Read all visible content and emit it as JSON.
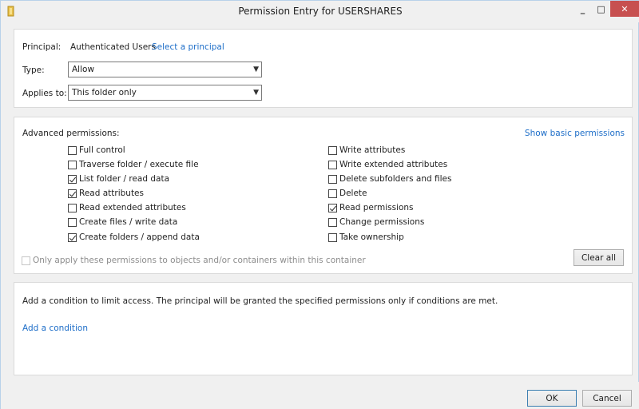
{
  "window": {
    "title": "Permission Entry for USERSHARES",
    "minimize_label": "_",
    "maximize_label": "□",
    "close_label": "✕"
  },
  "principal": {
    "label": "Principal:",
    "value": "Authenticated Users",
    "link": "Select a principal"
  },
  "type": {
    "label": "Type:",
    "value": "Allow"
  },
  "applies_to": {
    "label": "Applies to:",
    "value": "This folder only"
  },
  "permissions": {
    "heading": "Advanced permissions:",
    "show_basic_link": "Show basic permissions",
    "left": [
      {
        "label": "Full control",
        "checked": false
      },
      {
        "label": "Traverse folder / execute file",
        "checked": false
      },
      {
        "label": "List folder / read data",
        "checked": true
      },
      {
        "label": "Read attributes",
        "checked": true
      },
      {
        "label": "Read extended attributes",
        "checked": false
      },
      {
        "label": "Create files / write data",
        "checked": false
      },
      {
        "label": "Create folders / append data",
        "checked": true
      }
    ],
    "right": [
      {
        "label": "Write attributes",
        "checked": false
      },
      {
        "label": "Write extended attributes",
        "checked": false
      },
      {
        "label": "Delete subfolders and files",
        "checked": false
      },
      {
        "label": "Delete",
        "checked": false
      },
      {
        "label": "Read permissions",
        "checked": true
      },
      {
        "label": "Change permissions",
        "checked": false
      },
      {
        "label": "Take ownership",
        "checked": false
      }
    ],
    "only_apply_label": "Only apply these permissions to objects and/or containers within this container",
    "clear_all_label": "Clear all"
  },
  "condition": {
    "description": "Add a condition to limit access. The principal will be granted the specified permissions only if conditions are met.",
    "add_link": "Add a condition"
  },
  "footer": {
    "ok_label": "OK",
    "cancel_label": "Cancel"
  },
  "colors": {
    "link": "#1e6ec8",
    "close_button": "#c75050",
    "folder_icon": "#e8c04a"
  },
  "icons": {
    "title": "folder-icon"
  }
}
